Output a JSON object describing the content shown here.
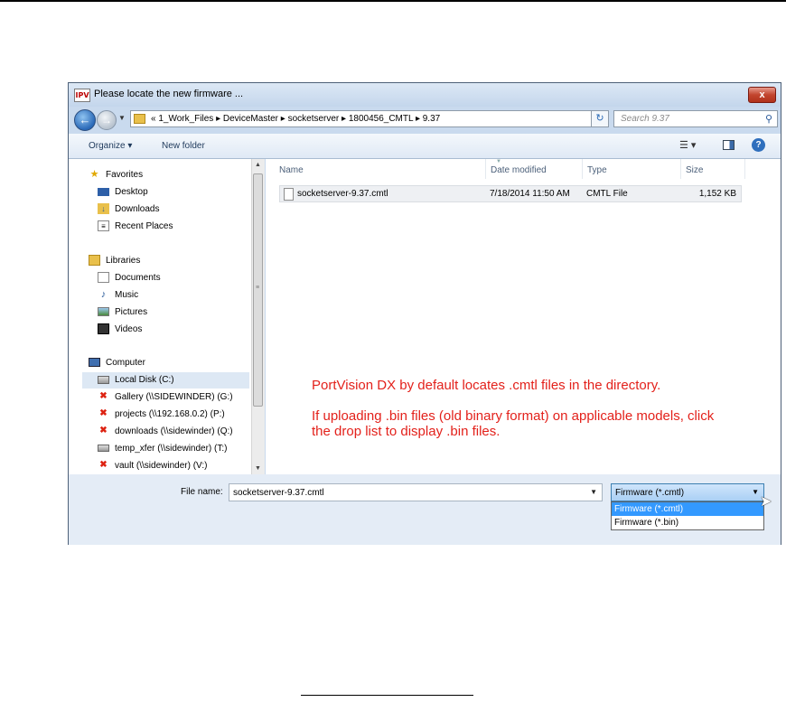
{
  "dialog": {
    "title": "Please locate the new firmware ...",
    "app_icon_text": "IPV",
    "close_label": "x"
  },
  "address": {
    "path": "«  1_Work_Files  ▸  DeviceMaster  ▸  socketserver  ▸  1800456_CMTL  ▸  9.37",
    "search_placeholder": "Search 9.37"
  },
  "toolbar": {
    "organize_label": "Organize ▾",
    "new_folder_label": "New folder"
  },
  "nav": {
    "favorites": "Favorites",
    "desktop": "Desktop",
    "downloads": "Downloads",
    "recent_places": "Recent Places",
    "libraries": "Libraries",
    "documents": "Documents",
    "music": "Music",
    "pictures": "Pictures",
    "videos": "Videos",
    "computer": "Computer",
    "local_disk": "Local Disk (C:)",
    "gallery": "Gallery (\\\\SIDEWINDER) (G:)",
    "projects": "projects (\\\\192.168.0.2) (P:)",
    "downloads_drive": "downloads (\\\\sidewinder) (Q:)",
    "temp_xfer": "temp_xfer (\\\\sidewinder) (T:)",
    "vault": "vault (\\\\sidewinder) (V:)"
  },
  "columns": {
    "name": "Name",
    "date_modified": "Date modified",
    "type": "Type",
    "size": "Size"
  },
  "files": [
    {
      "name": "socketserver-9.37.cmtl",
      "date": "7/18/2014 11:50 AM",
      "type": "CMTL File",
      "size": "1,152 KB"
    }
  ],
  "note": {
    "line1": "PortVision DX by default locates .cmtl files in the directory.",
    "line2": "If uploading .bin files (old binary format) on applicable models, click the drop list to display .bin files."
  },
  "bottom": {
    "file_name_label": "File name:",
    "file_name_value": "socketserver-9.37.cmtl",
    "file_type_selected": "Firmware (*.cmtl)",
    "file_type_options": [
      "Firmware (*.cmtl)",
      "Firmware (*.bin)"
    ]
  },
  "colors": {
    "note_text": "#e3211b",
    "selection": "#3399ff",
    "frame": "#c9daee"
  }
}
